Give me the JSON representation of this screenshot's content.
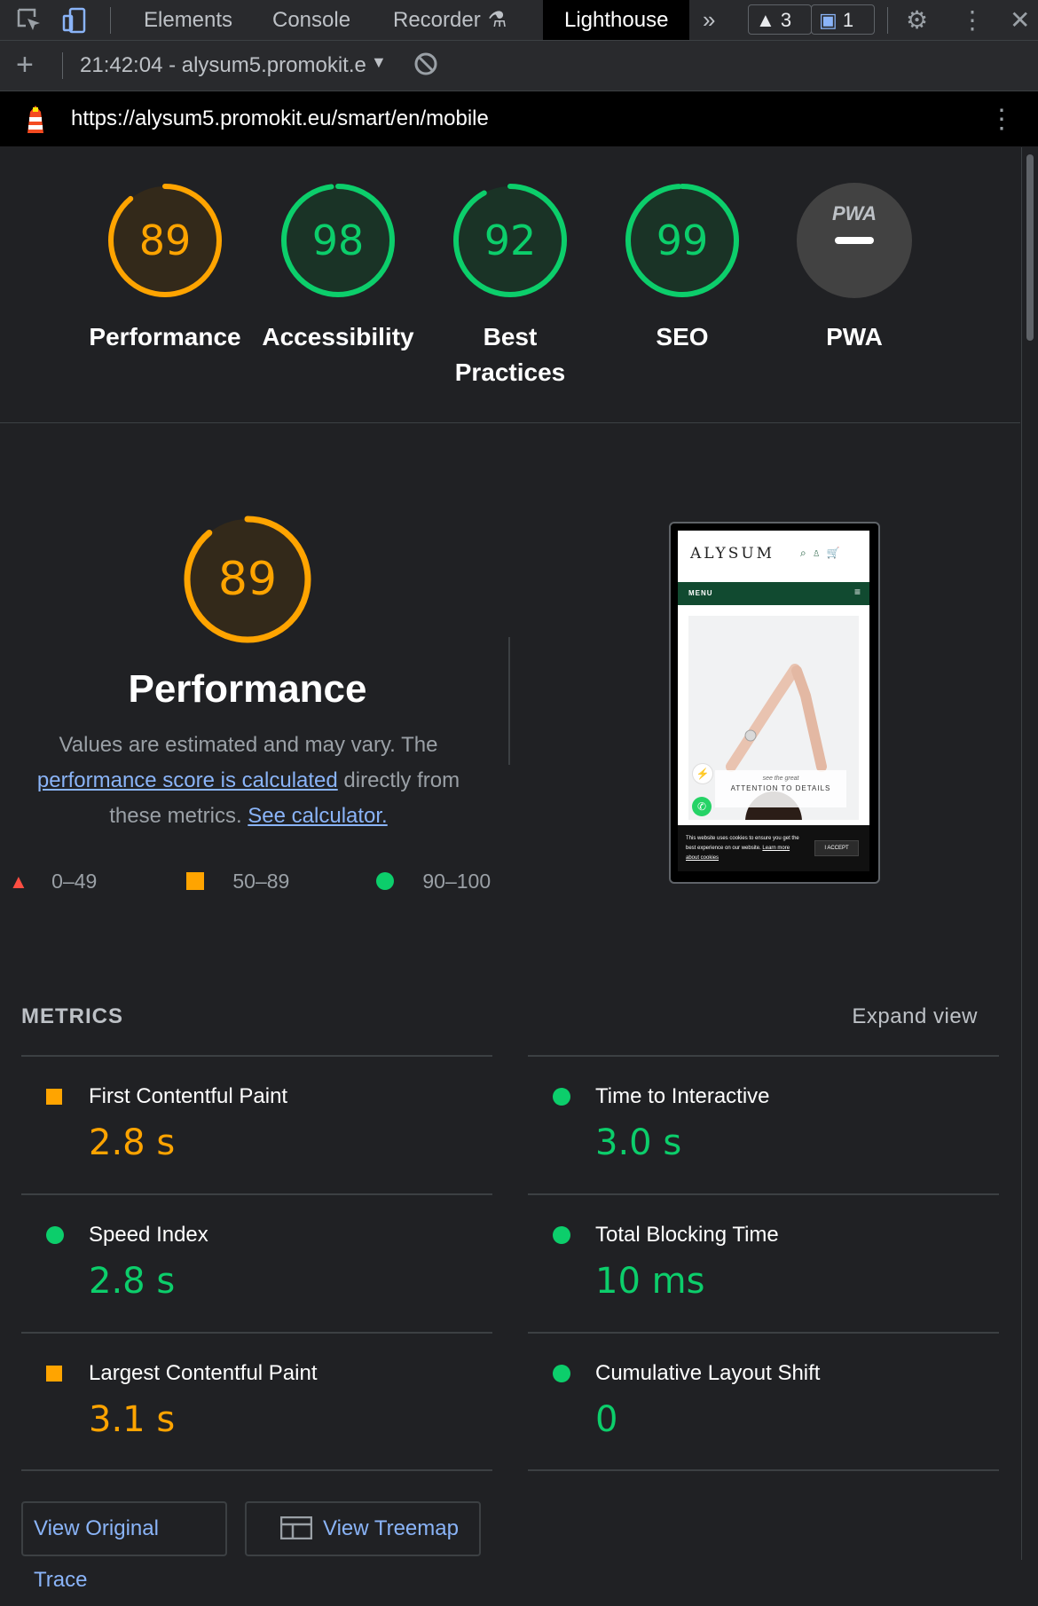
{
  "devtools": {
    "tabs": [
      "Elements",
      "Console",
      "Recorder",
      "Lighthouse"
    ],
    "active_tab": "Lighthouse",
    "warnings_count": "3",
    "messages_count": "1"
  },
  "report_bar": {
    "run_label": "21:42:04 - alysum5.promokit.e"
  },
  "url_bar": {
    "url": "https://alysum5.promokit.eu/smart/en/mobile"
  },
  "category_gauges": [
    {
      "name": "Performance",
      "score": "89",
      "fraction": 0.89,
      "status": "average"
    },
    {
      "name": "Accessibility",
      "score": "98",
      "fraction": 0.98,
      "status": "pass"
    },
    {
      "name": "Best Practices",
      "name_line1": "Best",
      "name_line2": "Practices",
      "score": "92",
      "fraction": 0.92,
      "status": "pass"
    },
    {
      "name": "SEO",
      "score": "99",
      "fraction": 0.99,
      "status": "pass"
    },
    {
      "name": "PWA",
      "score": "—",
      "status": "na",
      "badge": "PWA"
    }
  ],
  "performance": {
    "score": "89",
    "fraction": 0.89,
    "title": "Performance",
    "desc_before": "Values are estimated and may vary. The ",
    "desc_link": "performance score is calculated",
    "desc_middle": " directly from these metrics. ",
    "calc_link": "See calculator."
  },
  "legend": [
    {
      "range": "0–49",
      "status": "fail"
    },
    {
      "range": "50–89",
      "status": "average"
    },
    {
      "range": "90–100",
      "status": "pass"
    }
  ],
  "screenshot": {
    "brand": "ALYSUM",
    "menu": "MENU",
    "tagline": "see the great",
    "headline": "ATTENTION TO DETAILS",
    "cookie_text": "This website uses cookies to ensure you get the best experience on our website.",
    "cookie_link": "Learn more about cookies",
    "accept": "I ACCEPT"
  },
  "metrics": {
    "heading": "METRICS",
    "expand": "Expand view",
    "items": [
      {
        "name": "First Contentful Paint",
        "value": "2.8 s",
        "status": "average"
      },
      {
        "name": "Time to Interactive",
        "value": "3.0 s",
        "status": "pass"
      },
      {
        "name": "Speed Index",
        "value": "2.8 s",
        "status": "pass"
      },
      {
        "name": "Total Blocking Time",
        "value": "10 ms",
        "status": "pass"
      },
      {
        "name": "Largest Contentful Paint",
        "value": "3.1 s",
        "status": "average"
      },
      {
        "name": "Cumulative Layout Shift",
        "value": "0",
        "status": "pass"
      }
    ]
  },
  "buttons": {
    "trace": "View Original Trace",
    "treemap": "View Treemap"
  },
  "colors": {
    "pass": "#0cce6b",
    "average": "#ffa400",
    "fail": "#ff4e42",
    "link": "#8ab4f8"
  }
}
